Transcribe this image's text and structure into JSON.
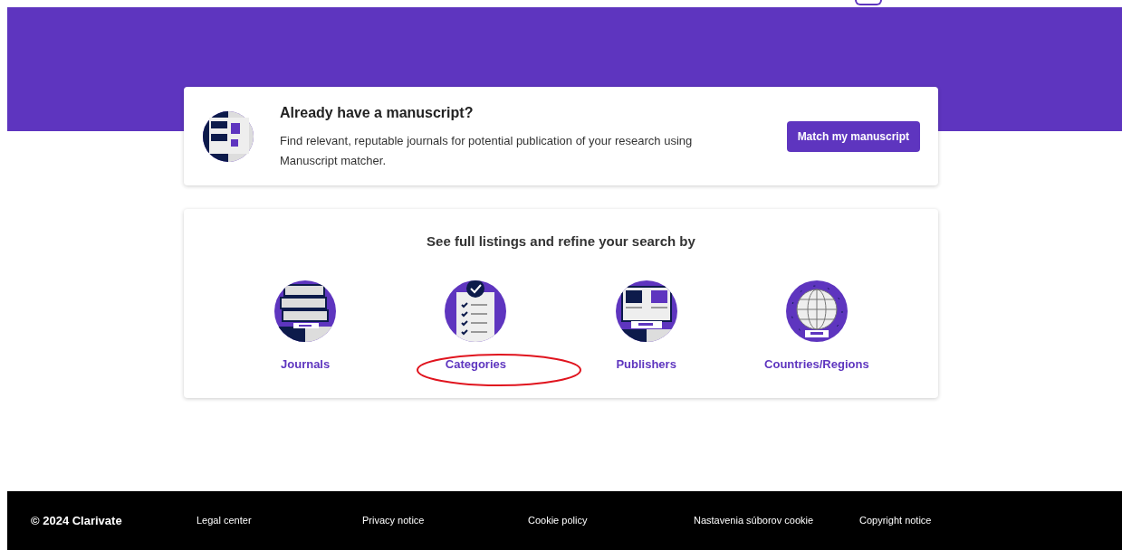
{
  "manuscript_card": {
    "title": "Already have a manuscript?",
    "description": "Find relevant, reputable journals for potential publication of your research using Manuscript matcher.",
    "button": "Match my manuscript"
  },
  "listings": {
    "heading": "See full listings and refine your search by",
    "items": [
      {
        "kind": "journals",
        "label": "Journals",
        "circled": false
      },
      {
        "kind": "categories",
        "label": "Categories",
        "circled": true
      },
      {
        "kind": "publishers",
        "label": "Publishers",
        "circled": false
      },
      {
        "kind": "countries",
        "label": "Countries/Regions",
        "circled": false
      }
    ]
  },
  "footer": {
    "copyright": "© 2024 Clarivate",
    "links": [
      "Legal center",
      "Privacy notice",
      "Cookie policy",
      "Nastavenia súborov cookie",
      "Copyright notice"
    ]
  }
}
